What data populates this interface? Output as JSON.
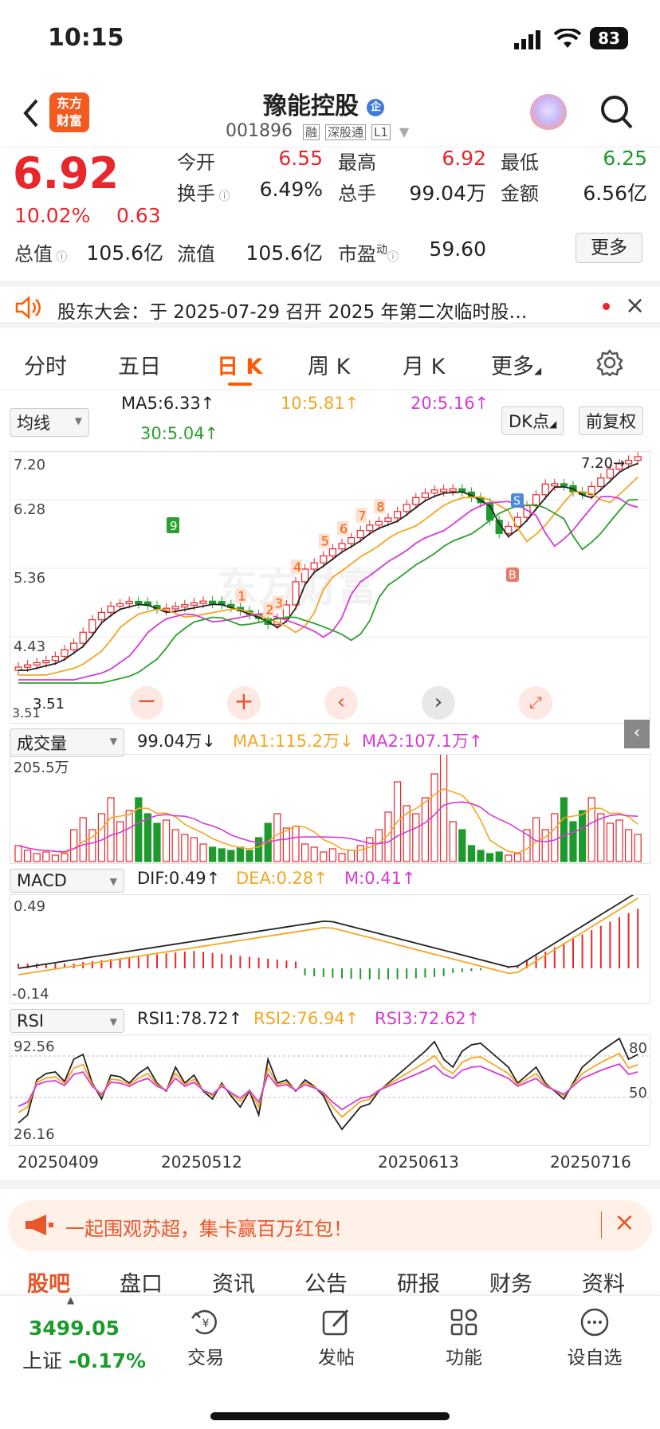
{
  "status": {
    "time": "10:15",
    "battery": "83"
  },
  "header": {
    "title": "豫能控股",
    "title_badge": "企",
    "code": "001896",
    "tags": [
      "融",
      "深股通",
      "L1"
    ],
    "logo_text_1": "东方",
    "logo_text_2": "财富"
  },
  "quote": {
    "price": "6.92",
    "change_pct": "10.02%",
    "change": "0.63",
    "open_label": "今开",
    "open": "6.55",
    "high_label": "最高",
    "high": "6.92",
    "low_label": "最低",
    "low": "6.25",
    "turnover_label": "换手",
    "turnover": "6.49%",
    "volume_label": "总手",
    "volume": "99.04万",
    "amount_label": "金额",
    "amount": "6.56亿",
    "mktcap_label": "总值",
    "mktcap": "105.6亿",
    "float_label": "流值",
    "float": "105.6亿",
    "pe_label": "市盈",
    "pe_sup": "动",
    "pe": "59.60",
    "more": "更多"
  },
  "notice": {
    "text": "股东大会：于 2025-07-29 召开 2025 年第二次临时股…"
  },
  "tabs": [
    "分时",
    "五日",
    "日 K",
    "周 K",
    "月 K",
    "更多"
  ],
  "kline": {
    "ma_select": "均线",
    "ma5": "MA5:6.33↑",
    "ma10": "10:5.81↑",
    "ma20": "20:5.16↑",
    "ma30": "30:5.04↑",
    "dk": "DK点",
    "adjust": "前复权",
    "y_labels": [
      "7.20",
      "6.28",
      "5.36",
      "4.43",
      "3.51"
    ],
    "max_marker": "7.20→",
    "min_marker": "3.51",
    "watermark": "东方财富",
    "signals": {
      "b": "B",
      "s": "S"
    },
    "colors": {
      "up": "#e8262b",
      "down": "#1c9b2c",
      "ma5": "#222222",
      "ma10": "#f5a623",
      "ma20": "#d63bd6",
      "ma30": "#2ca02c"
    }
  },
  "volume": {
    "select": "成交量",
    "value": "99.04万↓",
    "ma1": "MA1:115.2万↓",
    "ma2": "MA2:107.1万↑",
    "top_label": "205.5万"
  },
  "macd": {
    "select": "MACD",
    "dif": "DIF:0.49↑",
    "dea": "DEA:0.28↑",
    "m": "M:0.41↑",
    "top_label": "0.49",
    "bottom_label": "-0.14"
  },
  "rsi": {
    "select": "RSI",
    "rsi1": "RSI1:78.72↑",
    "rsi2": "RSI2:76.94↑",
    "rsi3": "RSI3:72.62↑",
    "top_label": "92.56",
    "bottom_label": "26.16",
    "line80": "80",
    "line50": "50"
  },
  "dates": [
    "20250409",
    "20250512",
    "20250613",
    "20250716"
  ],
  "banner": {
    "text": "一起围观苏超，集卡赢百万红包！"
  },
  "bottom_tabs": [
    "股吧",
    "盘口",
    "资讯",
    "公告",
    "研报",
    "财务",
    "资料"
  ],
  "index": {
    "value": "3499.05",
    "name": "上证",
    "change": "-0.17%"
  },
  "bottom_nav": [
    "交易",
    "发帖",
    "功能",
    "设自选"
  ]
}
